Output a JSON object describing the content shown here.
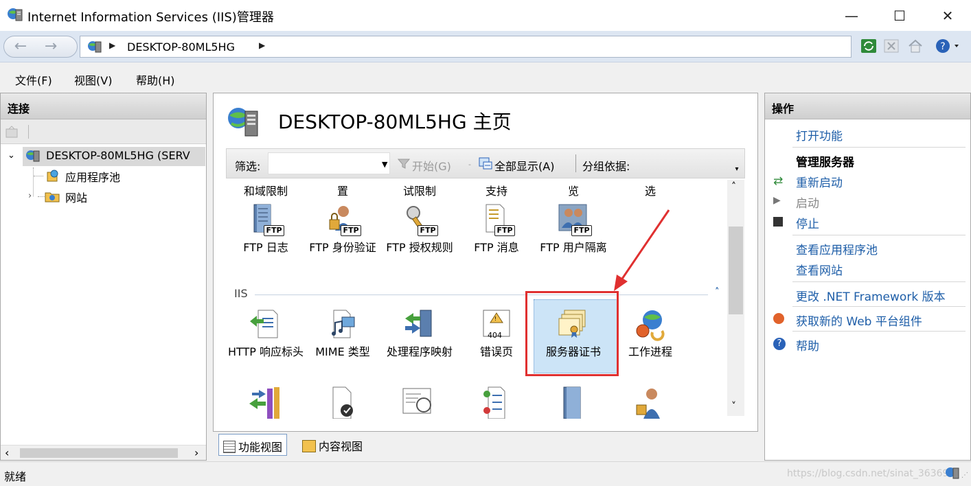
{
  "window": {
    "title": "Internet Information Services (IIS)管理器",
    "minimize": "—",
    "maximize": "☐",
    "close": "✕"
  },
  "address": {
    "path_item": "DESKTOP-80ML5HG"
  },
  "menu": [
    "文件(F)",
    "视图(V)",
    "帮助(H)"
  ],
  "connections": {
    "header": "连接",
    "server_node": "DESKTOP-80ML5HG (SERV",
    "children": [
      "应用程序池",
      "网站"
    ]
  },
  "center": {
    "title": "DESKTOP-80ML5HG 主页",
    "filter_label": "筛选:",
    "start_label": "开始(G)",
    "show_all_label": "全部显示(A)",
    "group_by_label": "分组依据:",
    "top_clipped_labels": [
      "和域限制",
      "置",
      "试限制",
      "支持",
      "览",
      "选"
    ],
    "ftp_row": [
      {
        "label": "FTP 日志",
        "icon": "ftp-logging-icon"
      },
      {
        "label": "FTP 身份验证",
        "icon": "ftp-authentication-icon"
      },
      {
        "label": "FTP 授权规则",
        "icon": "ftp-authorization-icon"
      },
      {
        "label": "FTP 消息",
        "icon": "ftp-messages-icon"
      },
      {
        "label": "FTP 用户隔离",
        "icon": "ftp-user-isolation-icon"
      }
    ],
    "ftp_badge": "FTP",
    "iis_group": "IIS",
    "iis_row": [
      {
        "label": "HTTP 响应标头",
        "icon": "http-response-headers-icon"
      },
      {
        "label": "MIME 类型",
        "icon": "mime-types-icon"
      },
      {
        "label": "处理程序映射",
        "icon": "handler-mappings-icon"
      },
      {
        "label": "错误页",
        "icon": "error-pages-icon"
      },
      {
        "label": "服务器证书",
        "icon": "server-certificates-icon"
      },
      {
        "label": "工作进程",
        "icon": "worker-processes-icon"
      }
    ],
    "error_badge": "404",
    "view_tabs": [
      "功能视图",
      "内容视图"
    ]
  },
  "actions": {
    "header": "操作",
    "open_feature": "打开功能",
    "manage_server": "管理服务器",
    "restart": "重新启动",
    "start": "启动",
    "stop": "停止",
    "view_app_pools": "查看应用程序池",
    "view_sites": "查看网站",
    "change_net": "更改 .NET Framework 版本",
    "get_web_components": "获取新的 Web 平台组件",
    "help": "帮助"
  },
  "status": {
    "text": "就绪",
    "watermark": "https://blog.csdn.net/sinat_36369"
  },
  "colors": {
    "link": "#1e5ea8",
    "highlight_box": "#e03030",
    "selection": "#cce4f7"
  }
}
